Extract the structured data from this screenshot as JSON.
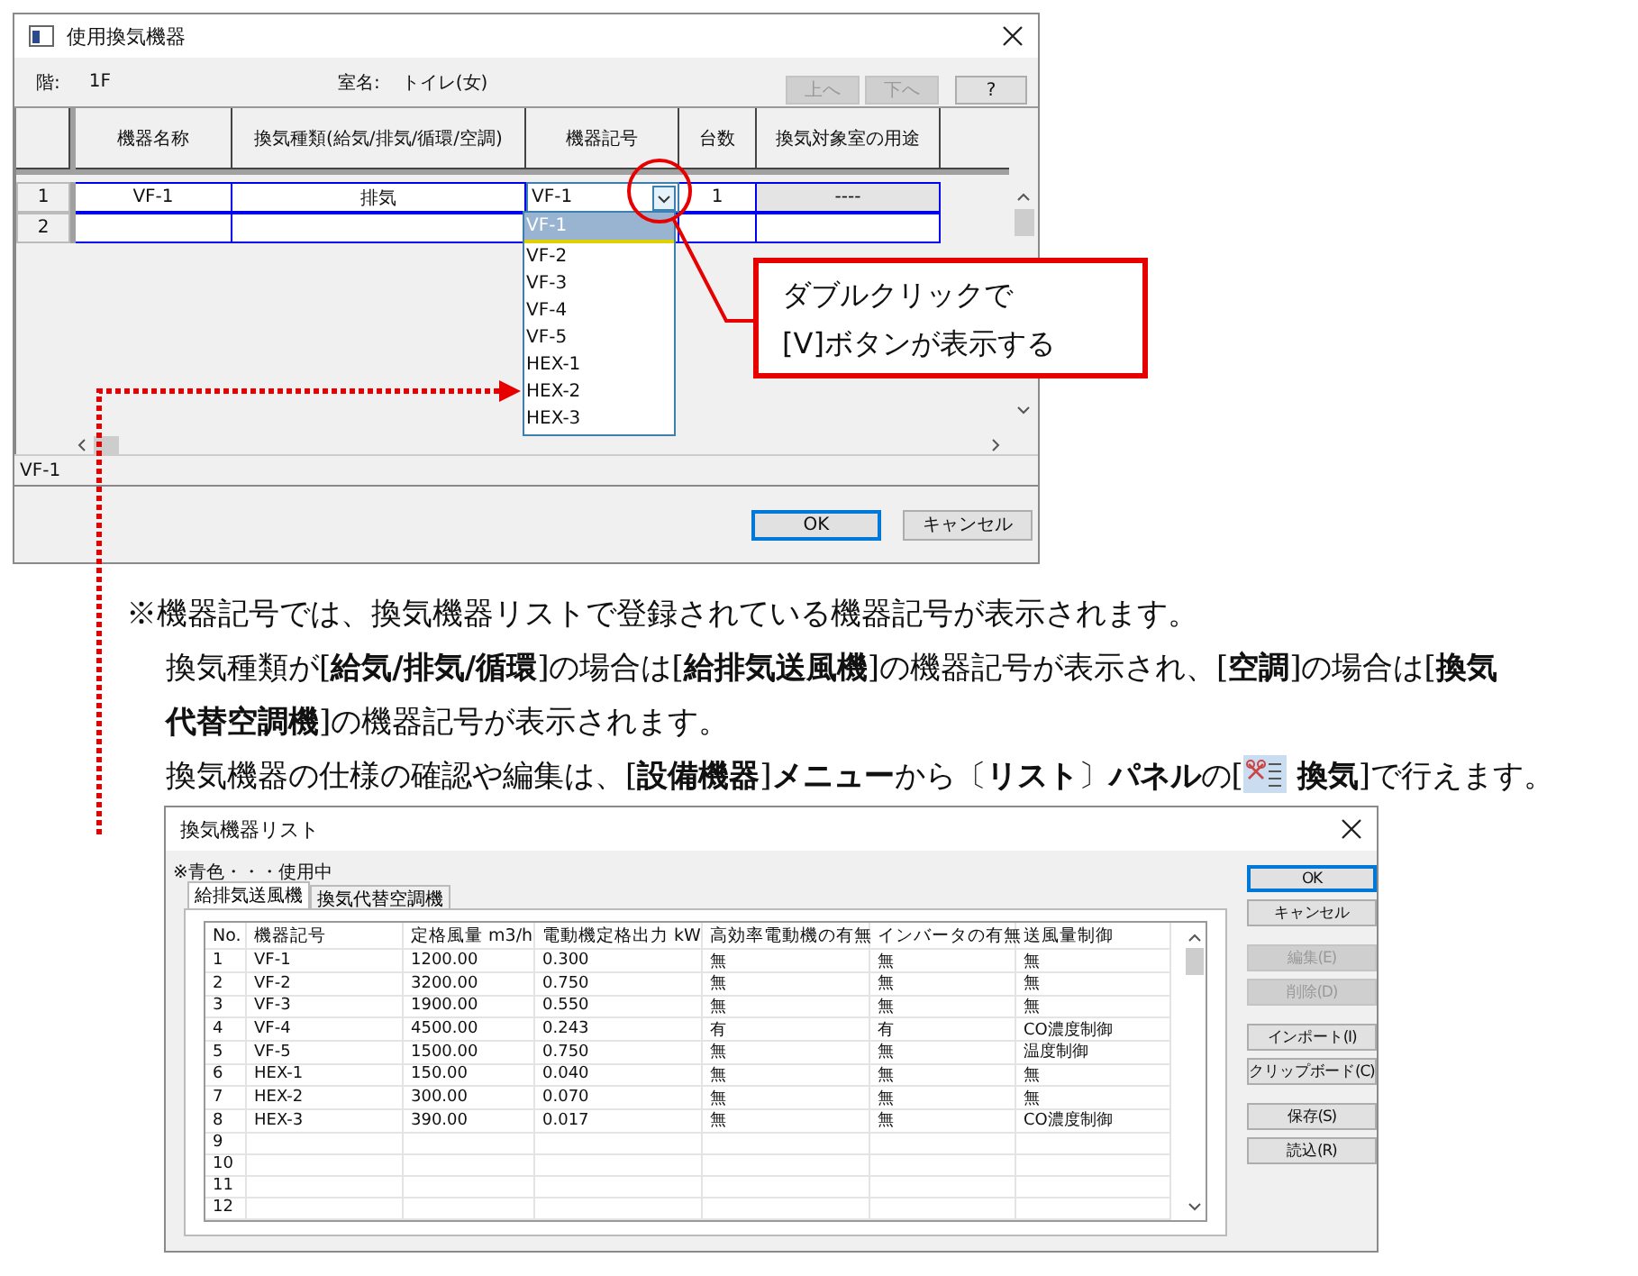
{
  "main_dialog": {
    "title": "使用換気機器",
    "floor_label": "階:",
    "floor": "1F",
    "room_label": "室名:",
    "room": "トイレ(女)",
    "nav_buttons": [
      {
        "label": "上へ",
        "disabled": true
      },
      {
        "label": "下へ",
        "disabled": true
      },
      {
        "label": "?",
        "disabled": false
      }
    ],
    "grid": {
      "columns": [
        "機器名称",
        "換気種類(給気/排気/循環/空調)",
        "機器記号",
        "台数",
        "換気対象室の用途"
      ],
      "rows": [
        {
          "number": "1",
          "cells": [
            {
              "kind": "text",
              "text": "VF-1"
            },
            {
              "kind": "text",
              "text": "排気"
            },
            {
              "kind": "combo",
              "text": "VF-1"
            },
            {
              "kind": "text",
              "text": "1"
            },
            {
              "kind": "readonly",
              "text": "----"
            }
          ]
        },
        {
          "number": "2",
          "cells": [
            {
              "kind": "text"
            },
            {
              "kind": "text"
            },
            {
              "kind": "text"
            },
            {
              "kind": "text"
            },
            {
              "kind": "text"
            }
          ]
        }
      ]
    },
    "dropdown": [
      {
        "label": "VF-1",
        "selected": true
      },
      {
        "label": "VF-2",
        "selected": false
      },
      {
        "label": "VF-3",
        "selected": false
      },
      {
        "label": "VF-4",
        "selected": false
      },
      {
        "label": "VF-5",
        "selected": false
      },
      {
        "label": "HEX-1",
        "selected": false
      },
      {
        "label": "HEX-2",
        "selected": false
      },
      {
        "label": "HEX-3",
        "selected": false
      }
    ],
    "status": "VF-1",
    "buttons": [
      {
        "label": "OK",
        "default": true
      },
      {
        "label": "キャンセル",
        "default": false
      }
    ]
  },
  "callout": {
    "lines": [
      "ダブルクリックで",
      "[V]ボタンが表示する"
    ]
  },
  "notes": [
    {
      "parts": [
        {
          "kind": "text",
          "text": "※機器記号では、換気機器リストで登録されている機器記号が表示されます。"
        }
      ]
    },
    {
      "parts": [
        {
          "kind": "text",
          "text": "換気種類が[**給気/排気/循環**]の場合は[**給排気送風機**]の機器記号が表示され、[**空調**]の場合は[**換気代替空調機**]の機器記号が表示されます。"
        }
      ]
    },
    {
      "parts": [
        {
          "kind": "text",
          "text": "換気機器の仕様の確認や編集は、[**設備機器**]**メニュー**から〔**リスト**〕**パネル**の["
        },
        {
          "kind": "icon"
        },
        {
          "kind": "text",
          "text": "**換気**]で行えます。"
        }
      ]
    }
  ],
  "list_dialog": {
    "title": "換気機器リスト",
    "legend": "※青色・・・使用中",
    "tabs": [
      {
        "label": "給排気送風機",
        "selected": true
      },
      {
        "label": "換気代替空調機",
        "selected": false
      }
    ],
    "columns": [
      "No.",
      "機器記号",
      "定格風量 m3/h",
      "電動機定格出力 kW",
      "高効率電動機の有無",
      "インバータの有無",
      "送風量制御"
    ],
    "rows": [
      {
        "no": "1",
        "cells": [
          "VF-1",
          "1200.00",
          "0.300",
          "無",
          "無",
          "無"
        ]
      },
      {
        "no": "2",
        "cells": [
          "VF-2",
          "3200.00",
          "0.750",
          "無",
          "無",
          "無"
        ]
      },
      {
        "no": "3",
        "cells": [
          "VF-3",
          "1900.00",
          "0.550",
          "無",
          "無",
          "無"
        ]
      },
      {
        "no": "4",
        "cells": [
          "VF-4",
          "4500.00",
          "0.243",
          "有",
          "有",
          "CO濃度制御"
        ]
      },
      {
        "no": "5",
        "cells": [
          "VF-5",
          "1500.00",
          "0.750",
          "無",
          "無",
          "温度制御"
        ]
      },
      {
        "no": "6",
        "cells": [
          "HEX-1",
          "150.00",
          "0.040",
          "無",
          "無",
          "無"
        ]
      },
      {
        "no": "7",
        "cells": [
          "HEX-2",
          "300.00",
          "0.070",
          "無",
          "無",
          "無"
        ]
      },
      {
        "no": "8",
        "cells": [
          "HEX-3",
          "390.00",
          "0.017",
          "無",
          "無",
          "CO濃度制御"
        ]
      },
      {
        "no": "9"
      },
      {
        "no": "10"
      },
      {
        "no": "11"
      },
      {
        "no": "12"
      }
    ],
    "button_groups": [
      {
        "buttons": [
          {
            "label": "OK",
            "default": true,
            "disabled": false
          },
          {
            "label": "キャンセル",
            "default": false,
            "disabled": false
          }
        ]
      },
      {
        "buttons": [
          {
            "label": "編集(E)",
            "default": false,
            "disabled": true
          },
          {
            "label": "削除(D)",
            "default": false,
            "disabled": true
          }
        ]
      },
      {
        "buttons": [
          {
            "label": "インポート(I)",
            "default": false,
            "disabled": false
          },
          {
            "label": "クリップボード(C)",
            "default": false,
            "disabled": false
          }
        ]
      },
      {
        "buttons": [
          {
            "label": "保存(S)",
            "default": false,
            "disabled": false
          },
          {
            "label": "読込(R)",
            "default": false,
            "disabled": false
          }
        ]
      }
    ]
  }
}
